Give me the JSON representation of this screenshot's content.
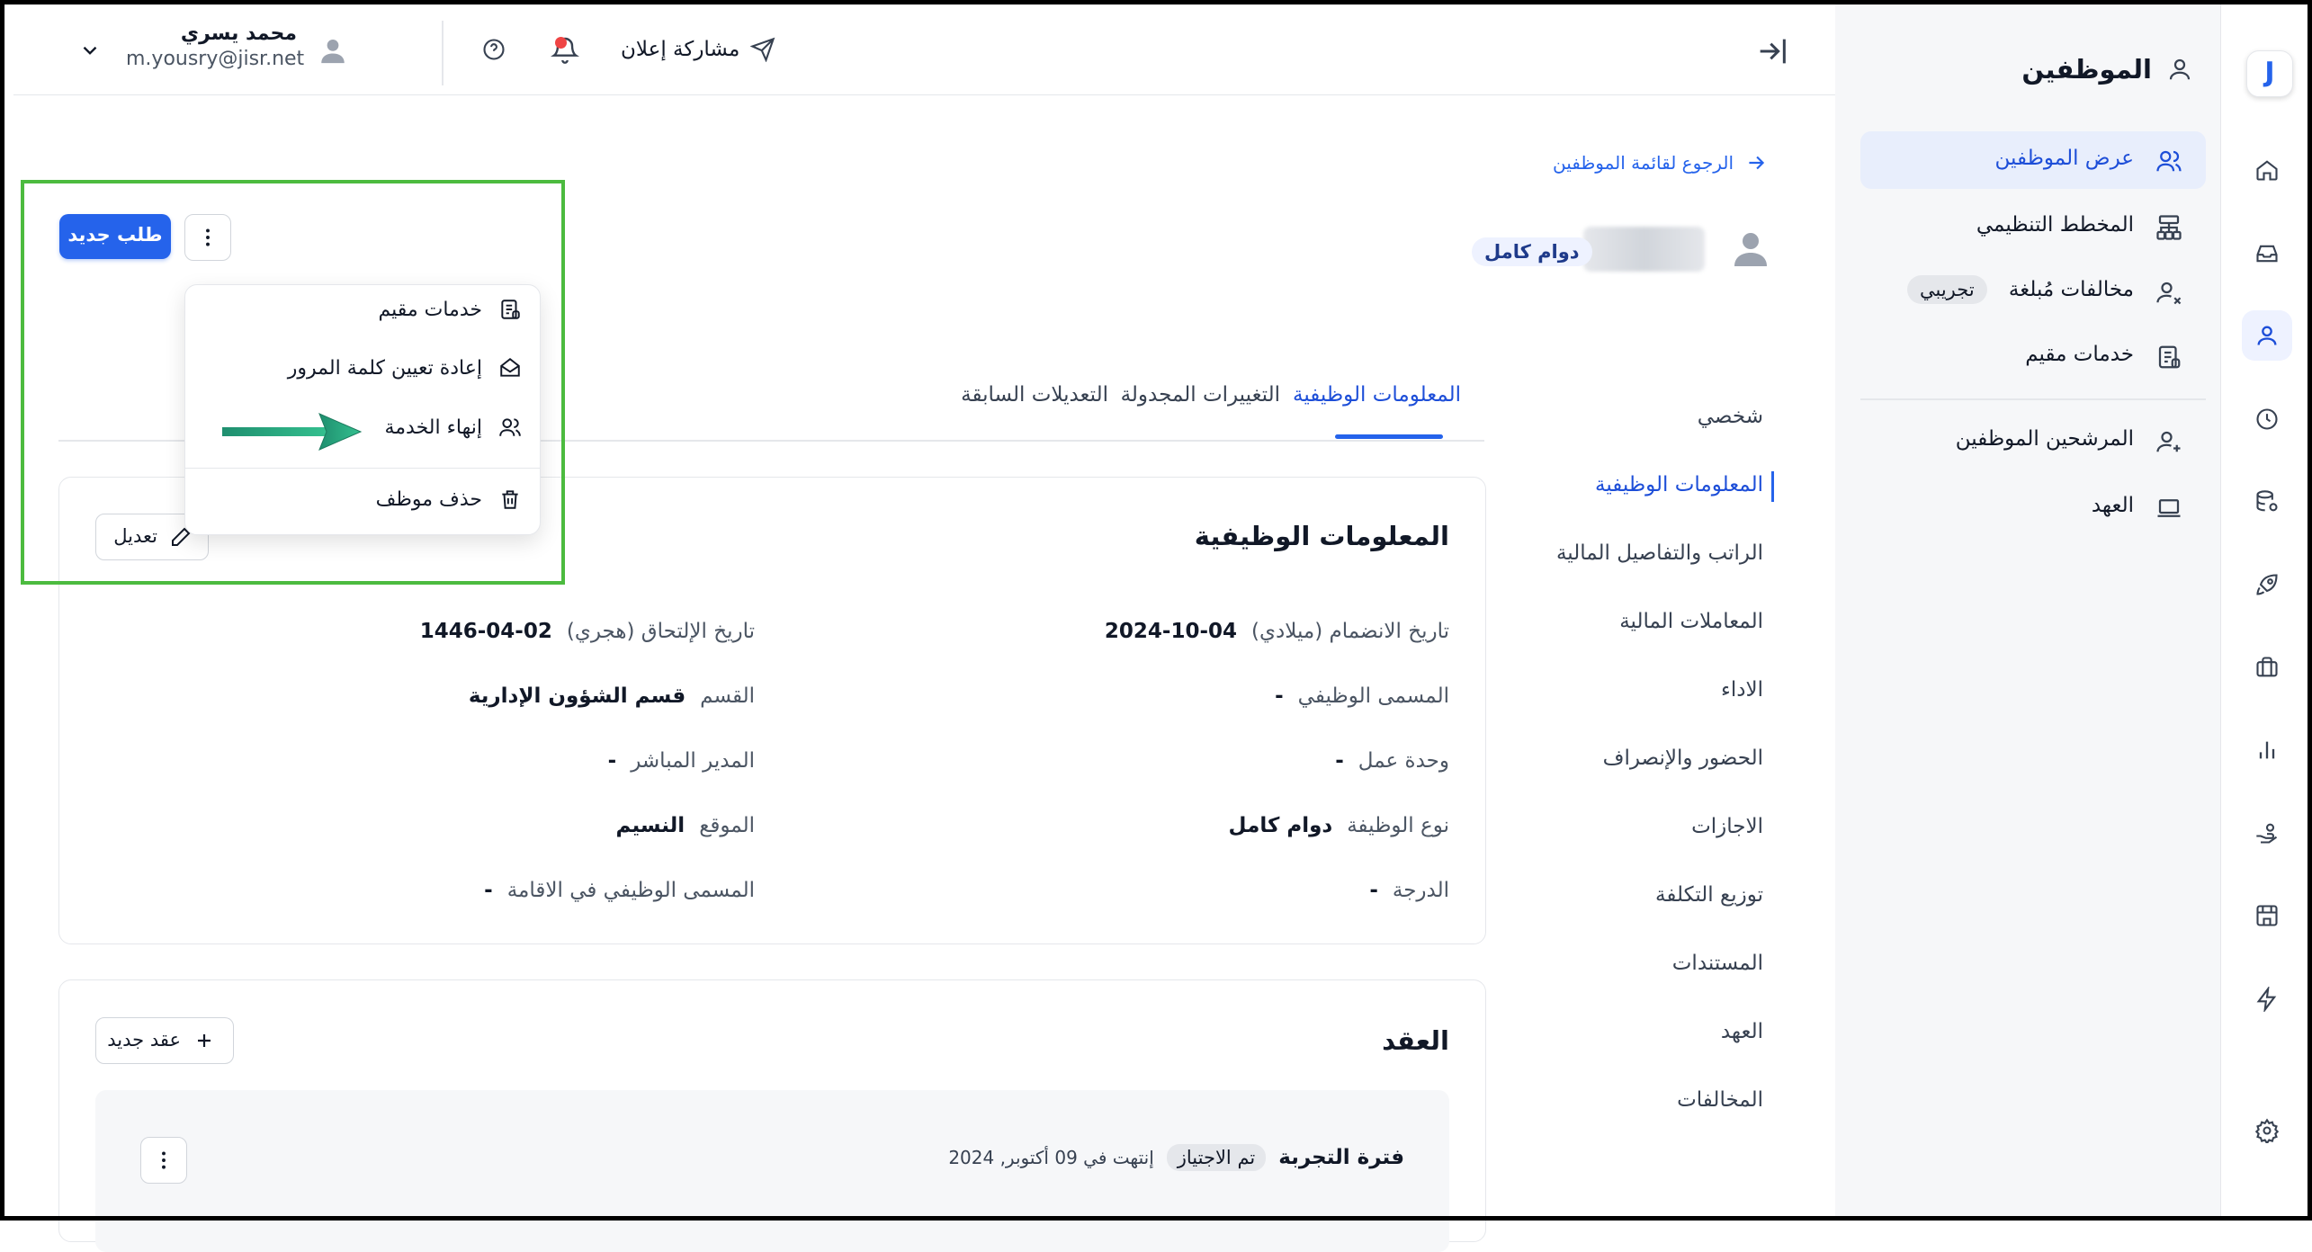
{
  "app": {
    "logo_letter": "J"
  },
  "rail": {
    "icons": [
      "home-icon",
      "inbox-icon",
      "person-icon",
      "clock-icon",
      "database-icon",
      "rocket-icon",
      "briefcase-icon",
      "bar-chart-icon",
      "hand-coin-icon",
      "store-icon",
      "lightning-icon",
      "settings-icon"
    ]
  },
  "sidebar": {
    "title": "الموظفين",
    "items": [
      {
        "label": "عرض الموظفين",
        "icon": "users-icon"
      },
      {
        "label": "المخطط التنظيمي",
        "icon": "org-chart-icon"
      },
      {
        "label": "مخالفات مُبلغة",
        "icon": "user-x-icon",
        "badge": "تجريبي"
      },
      {
        "label": "خدمات مقيم",
        "icon": "document-icon"
      },
      {
        "label": "المرشحين الموظفين",
        "icon": "user-plus-icon"
      },
      {
        "label": "العهد",
        "icon": "laptop-icon"
      }
    ]
  },
  "topbar": {
    "user_name": "محمد يسري",
    "user_email": "m.yousry@jisr.net",
    "share_label": "مشاركة إعلان"
  },
  "back_link": "الرجوع لقائمة الموظفين",
  "employee": {
    "status_badge": "دوام كامل"
  },
  "actions": {
    "new_request": "طلب جديد",
    "menu": [
      {
        "label": "خدمات مقيم",
        "icon": "document-icon"
      },
      {
        "label": "إعادة تعيين كلمة المرور",
        "icon": "envelope-open-icon"
      },
      {
        "label": "إنهاء الخدمة",
        "icon": "users-icon"
      },
      {
        "label": "حذف موظف",
        "icon": "trash-icon"
      }
    ]
  },
  "tabs": [
    "المعلومات الوظيفية",
    "التغييرات المجدولة",
    "التعديلات السابقة"
  ],
  "section_nav": [
    "شخصي",
    "المعلومات الوظيفية",
    "الراتب والتفاصيل المالية",
    "المعاملات المالية",
    "الاداء",
    "الحضور والإنصراف",
    "الاجازات",
    "توزيع التكلفة",
    "المستندات",
    "العهد",
    "المخالفات"
  ],
  "job_info": {
    "title": "المعلومات الوظيفية",
    "edit_label": "تعديل",
    "right_fields": [
      {
        "key": "تاريخ الانضمام (ميلادي)",
        "value": "2024-10-04"
      },
      {
        "key": "المسمى الوظيفي",
        "value": "-"
      },
      {
        "key": "وحدة عمل",
        "value": "-"
      },
      {
        "key": "نوع الوظيفة",
        "value": "دوام كامل"
      },
      {
        "key": "الدرجة",
        "value": "-"
      }
    ],
    "left_fields": [
      {
        "key": "تاريخ الإلتحاق (هجري)",
        "value": "1446-04-02"
      },
      {
        "key": "القسم",
        "value": "قسم الشؤون الإدارية"
      },
      {
        "key": "المدير المباشر",
        "value": "-"
      },
      {
        "key": "الموقع",
        "value": "النسيم"
      },
      {
        "key": "المسمى الوظيفي في الاقامة",
        "value": "-"
      }
    ]
  },
  "contract": {
    "title": "العقد",
    "new_label": "عقد جديد",
    "period_label": "فترة التجربة",
    "period_status": "تم الاجتياز",
    "period_end": "إنتهت في 09 أكتوبر, 2024"
  },
  "colors": {
    "accent": "#2563eb",
    "highlight": "#4cbb3f",
    "arrow": "#2aa683",
    "notif": "#ef4444"
  }
}
